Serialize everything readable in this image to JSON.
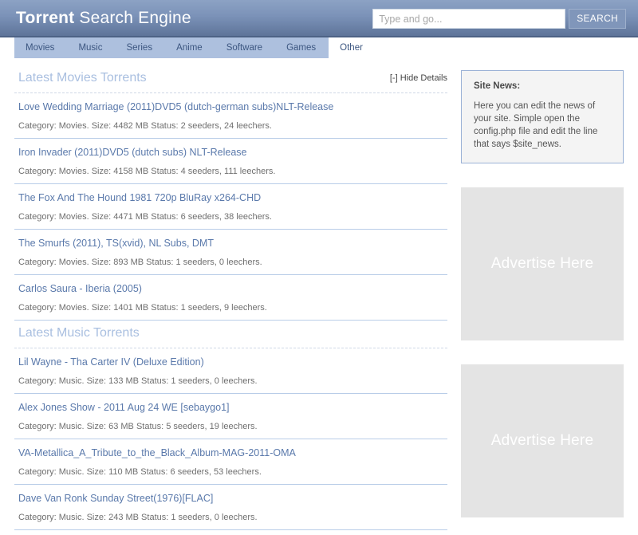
{
  "header": {
    "logo_strong": "Torrent",
    "logo_light": " Search Engine",
    "search_placeholder": "Type and go...",
    "search_value": "",
    "search_button": "SEARCH"
  },
  "nav": {
    "items": [
      {
        "label": "Movies"
      },
      {
        "label": "Music"
      },
      {
        "label": "Series"
      },
      {
        "label": "Anime"
      },
      {
        "label": "Software"
      },
      {
        "label": "Games"
      },
      {
        "label": "Other"
      }
    ]
  },
  "sections": [
    {
      "title": "Latest Movies Torrents",
      "toggle_label": "[-] Hide Details",
      "items": [
        {
          "title": "Love Wedding Marriage (2011)DVD5 (dutch-german subs)NLT-Release",
          "meta": "Category: Movies. Size: 4482 MB Status: 2 seeders, 24 leechers."
        },
        {
          "title": "Iron Invader (2011)DVD5 (dutch subs) NLT-Release",
          "meta": "Category: Movies. Size: 4158 MB Status: 4 seeders, 111 leechers."
        },
        {
          "title": "The Fox And The Hound 1981 720p BluRay x264-CHD",
          "meta": "Category: Movies. Size: 4471 MB Status: 6 seeders, 38 leechers."
        },
        {
          "title": "The Smurfs (2011), TS(xvid), NL Subs, DMT",
          "meta": "Category: Movies. Size: 893 MB Status: 1 seeders, 0 leechers."
        },
        {
          "title": "Carlos Saura - Iberia (2005)",
          "meta": "Category: Movies. Size: 1401 MB Status: 1 seeders, 9 leechers."
        }
      ]
    },
    {
      "title": "Latest Music Torrents",
      "toggle_label": "",
      "items": [
        {
          "title": "Lil Wayne - Tha Carter IV (Deluxe Edition)",
          "meta": "Category: Music. Size: 133 MB Status: 1 seeders, 0 leechers."
        },
        {
          "title": "Alex Jones Show - 2011 Aug 24 WE [sebaygo1]",
          "meta": "Category: Music. Size: 63 MB Status: 5 seeders, 19 leechers."
        },
        {
          "title": "VA-Metallica_A_Tribute_to_the_Black_Album-MAG-2011-OMA",
          "meta": "Category: Music. Size: 110 MB Status: 6 seeders, 53 leechers."
        },
        {
          "title": "Dave Van Ronk Sunday Street(1976)[FLAC]",
          "meta": "Category: Music. Size: 243 MB Status: 1 seeders, 0 leechers."
        }
      ]
    }
  ],
  "sidebar": {
    "news_title": "Site News:",
    "news_text": "Here you can edit the news of your site. Simple open the config.php file and edit the line that says $site_news.",
    "ads": [
      {
        "label": "Advertise Here"
      },
      {
        "label": "Advertise Here"
      }
    ]
  },
  "colors": {
    "header_top": "#8ca2c4",
    "header_bottom": "#5e7499",
    "nav_bg": "#adc0de",
    "link": "#5a79ab",
    "section_title": "#a9bfe0",
    "ad_bg": "#e4e4e4"
  }
}
